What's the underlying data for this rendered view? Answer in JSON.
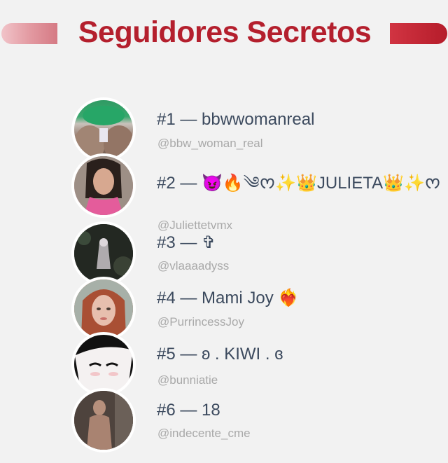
{
  "header": {
    "title": "Seguidores Secretos"
  },
  "followers": [
    {
      "rank_name": "#1 — bbwwomanreal",
      "handle": "@bbw_woman_real"
    },
    {
      "rank_name": "#2 — 😈🔥༄ᰔ✨👑JULIETA👑✨ᰔ",
      "handle": "@Juliettetvmx"
    },
    {
      "rank_name": "#3 — ✞",
      "handle": "@vlaaaadyss"
    },
    {
      "rank_name": "#4 — Mami Joy ❤️‍🔥",
      "handle": "@PurrincessJoy"
    },
    {
      "rank_name": "#5 — ʚ . KIWI . ɞ",
      "handle": "@bunniatie"
    },
    {
      "rank_name": "#6 — 18",
      "handle": "@indecente_cme"
    }
  ],
  "colors": {
    "accent": "#b41f2d",
    "name_text": "#3c4a5e",
    "handle_text": "#a9a9a9",
    "background": "#f2f2f2"
  }
}
